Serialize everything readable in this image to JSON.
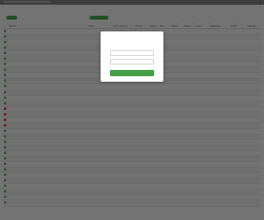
{
  "header": {
    "brand": "",
    "green_pill_left": "",
    "green_pill_mid": ""
  },
  "table": {
    "columns": [
      "",
      "Name",
      "Type",
      "Acc Country",
      "Status",
      "Users",
      "Pct",
      "Views",
      "Clicks",
      "Conv",
      "Revenue",
      "Profit",
      "Margin"
    ],
    "rows": [
      {
        "flag": "green",
        "name": "",
        "type": "",
        "country": "",
        "status": "",
        "users": "",
        "pct": "",
        "views": "",
        "clicks": "",
        "conv": "",
        "revenue": "",
        "profit": "",
        "margin": ""
      },
      {
        "flag": "green",
        "name": "",
        "type": "",
        "country": "",
        "status": "",
        "users": "",
        "pct": "",
        "views": "",
        "clicks": "",
        "conv": "",
        "revenue": "",
        "profit": "",
        "margin": ""
      },
      {
        "flag": "green",
        "name": "",
        "type": "",
        "country": "",
        "status": "",
        "users": "",
        "pct": "",
        "views": "",
        "clicks": "",
        "conv": "",
        "revenue": "",
        "profit": "",
        "margin": ""
      },
      {
        "flag": "green",
        "name": "",
        "type": "",
        "country": "",
        "status": "",
        "users": "",
        "pct": "",
        "views": "",
        "clicks": "",
        "conv": "",
        "revenue": "",
        "profit": "",
        "margin": ""
      },
      {
        "flag": "green",
        "name": "",
        "type": "",
        "country": "",
        "status": "",
        "users": "",
        "pct": "",
        "views": "",
        "clicks": "",
        "conv": "",
        "revenue": "",
        "profit": "",
        "margin": ""
      },
      {
        "flag": "green",
        "name": "",
        "type": "",
        "country": "",
        "status": "",
        "users": "",
        "pct": "",
        "views": "",
        "clicks": "",
        "conv": "",
        "revenue": "",
        "profit": "",
        "margin": ""
      },
      {
        "flag": "green",
        "name": "",
        "type": "",
        "country": "",
        "status": "",
        "users": "",
        "pct": "",
        "views": "",
        "clicks": "",
        "conv": "",
        "revenue": "",
        "profit": "",
        "margin": ""
      },
      {
        "flag": "green",
        "name": "",
        "type": "",
        "country": "",
        "status": "",
        "users": "",
        "pct": "",
        "views": "",
        "clicks": "",
        "conv": "",
        "revenue": "",
        "profit": "",
        "margin": ""
      },
      {
        "flag": "green",
        "name": "",
        "type": "",
        "country": "",
        "status": "",
        "users": "",
        "pct": "",
        "views": "",
        "clicks": "",
        "conv": "",
        "revenue": "",
        "profit": "",
        "margin": ""
      },
      {
        "flag": "green",
        "name": "",
        "type": "",
        "country": "",
        "status": "",
        "users": "",
        "pct": "",
        "views": "",
        "clicks": "",
        "conv": "",
        "revenue": "",
        "profit": "",
        "margin": ""
      },
      {
        "flag": "green",
        "name": "",
        "type": "",
        "country": "",
        "status": "",
        "users": "",
        "pct": "",
        "views": "",
        "clicks": "",
        "conv": "",
        "revenue": "",
        "profit": "",
        "margin": ""
      },
      {
        "flag": "green",
        "name": "",
        "type": "",
        "country": "",
        "status": "",
        "users": "",
        "pct": "",
        "views": "",
        "clicks": "",
        "conv": "",
        "revenue": "",
        "profit": "",
        "margin": ""
      },
      {
        "flag": "green",
        "name": "",
        "type": "",
        "country": "",
        "status": "",
        "users": "",
        "pct": "",
        "views": "",
        "clicks": "",
        "conv": "",
        "revenue": "",
        "profit": "",
        "margin": ""
      },
      {
        "flag": "green",
        "name": "",
        "type": "",
        "country": "",
        "status": "",
        "users": "",
        "pct": "",
        "views": "",
        "clicks": "",
        "conv": "",
        "revenue": "",
        "profit": "",
        "margin": ""
      },
      {
        "flag": "red",
        "name": "",
        "type": "",
        "country": "",
        "status": "",
        "users": "",
        "pct": "",
        "views": "",
        "clicks": "",
        "conv": "",
        "revenue": "",
        "profit": "",
        "margin": ""
      },
      {
        "flag": "red",
        "name": "",
        "type": "",
        "country": "",
        "status": "",
        "users": "",
        "pct": "",
        "views": "",
        "clicks": "",
        "conv": "",
        "revenue": "",
        "profit": "",
        "margin": ""
      },
      {
        "flag": "red",
        "name": "",
        "type": "",
        "country": "",
        "status": "",
        "users": "",
        "pct": "",
        "views": "",
        "clicks": "",
        "conv": "",
        "revenue": "",
        "profit": "",
        "margin": ""
      },
      {
        "flag": "red",
        "name": "",
        "type": "",
        "country": "",
        "status": "",
        "users": "",
        "pct": "",
        "views": "",
        "clicks": "",
        "conv": "",
        "revenue": "",
        "profit": "",
        "margin": ""
      },
      {
        "flag": "green",
        "name": "",
        "type": "",
        "country": "",
        "status": "",
        "users": "",
        "pct": "",
        "views": "",
        "clicks": "",
        "conv": "",
        "revenue": "",
        "profit": "",
        "margin": ""
      },
      {
        "flag": "green",
        "name": "",
        "type": "",
        "country": "",
        "status": "",
        "users": "",
        "pct": "",
        "views": "",
        "clicks": "",
        "conv": "",
        "revenue": "",
        "profit": "",
        "margin": ""
      },
      {
        "flag": "green",
        "name": "",
        "type": "",
        "country": "",
        "status": "",
        "users": "",
        "pct": "",
        "views": "",
        "clicks": "",
        "conv": "",
        "revenue": "",
        "profit": "",
        "margin": ""
      },
      {
        "flag": "green",
        "name": "",
        "type": "",
        "country": "",
        "status": "",
        "users": "",
        "pct": "",
        "views": "",
        "clicks": "",
        "conv": "",
        "revenue": "",
        "profit": "",
        "margin": ""
      },
      {
        "flag": "green",
        "name": "",
        "type": "",
        "country": "",
        "status": "",
        "users": "",
        "pct": "",
        "views": "",
        "clicks": "",
        "conv": "",
        "revenue": "",
        "profit": "",
        "margin": ""
      },
      {
        "flag": "green",
        "name": "",
        "type": "",
        "country": "",
        "status": "",
        "users": "",
        "pct": "",
        "views": "",
        "clicks": "",
        "conv": "",
        "revenue": "",
        "profit": "",
        "margin": ""
      },
      {
        "flag": "green",
        "name": "",
        "type": "",
        "country": "",
        "status": "",
        "users": "",
        "pct": "",
        "views": "",
        "clicks": "",
        "conv": "",
        "revenue": "",
        "profit": "",
        "margin": ""
      },
      {
        "flag": "green",
        "name": "",
        "type": "",
        "country": "",
        "status": "",
        "users": "",
        "pct": "",
        "views": "",
        "clicks": "",
        "conv": "",
        "revenue": "",
        "profit": "",
        "margin": ""
      },
      {
        "flag": "green",
        "name": "",
        "type": "",
        "country": "",
        "status": "",
        "users": "",
        "pct": "",
        "views": "",
        "clicks": "",
        "conv": "",
        "revenue": "",
        "profit": "",
        "margin": ""
      },
      {
        "flag": "green",
        "name": "",
        "type": "",
        "country": "",
        "status": "",
        "users": "",
        "pct": "",
        "views": "",
        "clicks": "",
        "conv": "",
        "revenue": "",
        "profit": "",
        "margin": ""
      },
      {
        "flag": "green",
        "name": "",
        "type": "",
        "country": "",
        "status": "",
        "users": "",
        "pct": "",
        "views": "",
        "clicks": "",
        "conv": "",
        "revenue": "",
        "profit": "",
        "margin": ""
      },
      {
        "flag": "green",
        "name": "",
        "type": "",
        "country": "",
        "status": "",
        "users": "",
        "pct": "",
        "views": "",
        "clicks": "",
        "conv": "",
        "revenue": "",
        "profit": "",
        "margin": ""
      },
      {
        "flag": "green",
        "name": "",
        "type": "",
        "country": "",
        "status": "",
        "users": "",
        "pct": "",
        "views": "",
        "clicks": "",
        "conv": "",
        "revenue": "",
        "profit": "",
        "margin": ""
      },
      {
        "flag": "green",
        "name": "",
        "type": "",
        "country": "",
        "status": "",
        "users": "",
        "pct": "",
        "views": "",
        "clicks": "",
        "conv": "",
        "revenue": "",
        "profit": "",
        "margin": ""
      }
    ]
  },
  "login_modal": {
    "username_placeholder": "",
    "password_placeholder": "",
    "submit_label": ""
  },
  "colors": {
    "accent_green": "#43a047",
    "overlay": "rgba(0,0,0,0.55)"
  },
  "icons": {
    "column_icon_1": "column-icon",
    "column_icon_2": "column-icon",
    "column_icon_3": "column-icon",
    "column_icon_4": "column-icon"
  }
}
